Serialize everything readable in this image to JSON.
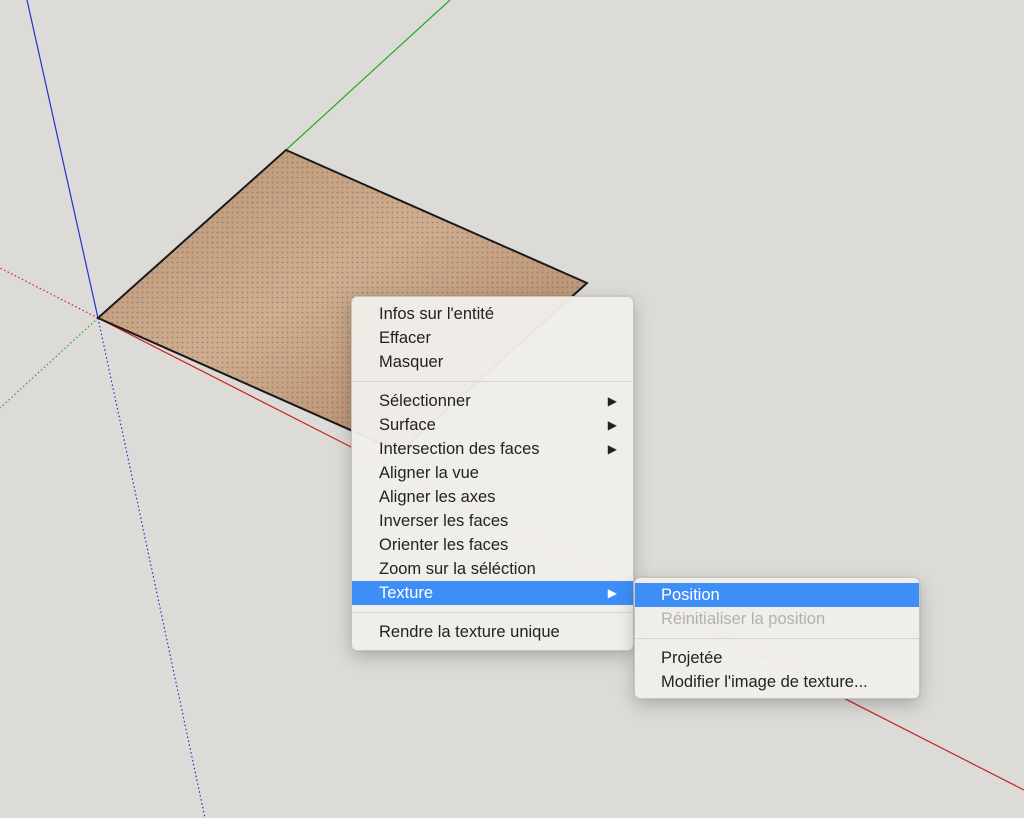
{
  "context_menu": {
    "groups": [
      {
        "items": [
          {
            "label": "Infos sur l'entité"
          },
          {
            "label": "Effacer"
          },
          {
            "label": "Masquer"
          }
        ]
      },
      {
        "items": [
          {
            "label": "Sélectionner",
            "submenu": true
          },
          {
            "label": "Surface",
            "submenu": true
          },
          {
            "label": "Intersection des faces",
            "submenu": true
          },
          {
            "label": "Aligner la vue"
          },
          {
            "label": "Aligner les axes"
          },
          {
            "label": "Inverser les faces"
          },
          {
            "label": "Orienter les faces"
          },
          {
            "label": "Zoom sur la séléction"
          },
          {
            "label": "Texture",
            "submenu": true,
            "highlighted": true
          }
        ]
      },
      {
        "items": [
          {
            "label": "Rendre la texture unique"
          }
        ]
      }
    ],
    "submenu_arrow": "▶"
  },
  "texture_submenu": {
    "groups": [
      {
        "items": [
          {
            "label": "Position",
            "highlighted": true
          },
          {
            "label": "Réinitialiser la position",
            "disabled": true
          }
        ]
      },
      {
        "items": [
          {
            "label": "Projetée"
          },
          {
            "label": "Modifier l'image de texture..."
          }
        ]
      }
    ]
  },
  "colors": {
    "background": "#dcdbd8",
    "axis_red": "#cc2222",
    "axis_green": "#22aa22",
    "axis_blue": "#2233cc",
    "highlight": "#3e8ef7",
    "face_texture": "#c09a78"
  }
}
